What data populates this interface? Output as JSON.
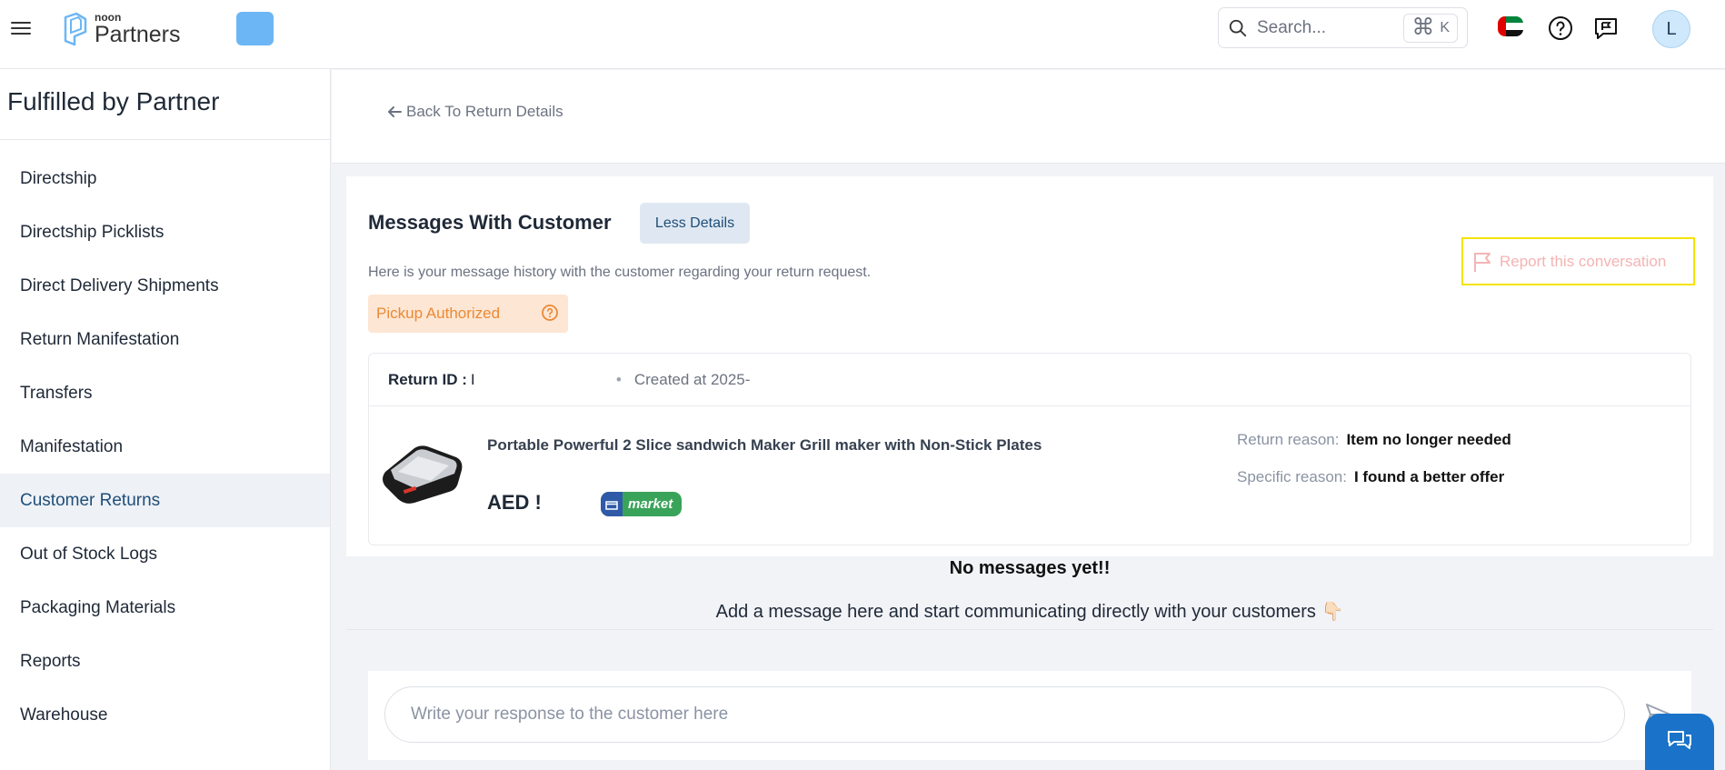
{
  "header": {
    "logo_small": "noon",
    "logo_big": "Partners",
    "search_placeholder": "Search...",
    "shortcut_symbol": "⌘",
    "shortcut_key": "K",
    "avatar_initial": "L"
  },
  "sidebar": {
    "title": "Fulfilled by Partner",
    "items": [
      {
        "label": "Directship"
      },
      {
        "label": "Directship Picklists"
      },
      {
        "label": "Direct Delivery Shipments"
      },
      {
        "label": "Return Manifestation"
      },
      {
        "label": "Transfers"
      },
      {
        "label": "Manifestation"
      },
      {
        "label": "Customer Returns",
        "active": true
      },
      {
        "label": "Out of Stock Logs"
      },
      {
        "label": "Packaging Materials"
      },
      {
        "label": "Reports"
      },
      {
        "label": "Warehouse"
      }
    ]
  },
  "back_link": "Back To Return Details",
  "messages": {
    "title": "Messages With Customer",
    "less_details": "Less Details",
    "report": "Report this conversation",
    "subtitle": "Here is your message history with the customer regarding your return request.",
    "status": "Pickup Authorized"
  },
  "return_card": {
    "return_id_label": "Return ID :",
    "return_id_value": "I",
    "created": "Created at 2025-",
    "product_name": "Portable Powerful 2 Slice sandwich Maker Grill maker with Non-Stick Plates",
    "price": "AED !",
    "market_label": "market",
    "return_reason_label": "Return reason:",
    "return_reason_value": "Item no longer needed",
    "specific_reason_label": "Specific reason:",
    "specific_reason_value": "I found a better offer"
  },
  "empty_state": {
    "title": "No messages yet!!",
    "text": "Add a message here and start communicating directly with your customers 👇🏻"
  },
  "composer": {
    "placeholder": "Write your response to the customer here"
  },
  "colors": {
    "active_nav": "#1f4e79",
    "status_orange": "#ea8a35",
    "report_highlight": "#f5e400",
    "chat_blue": "#1a73c9"
  }
}
